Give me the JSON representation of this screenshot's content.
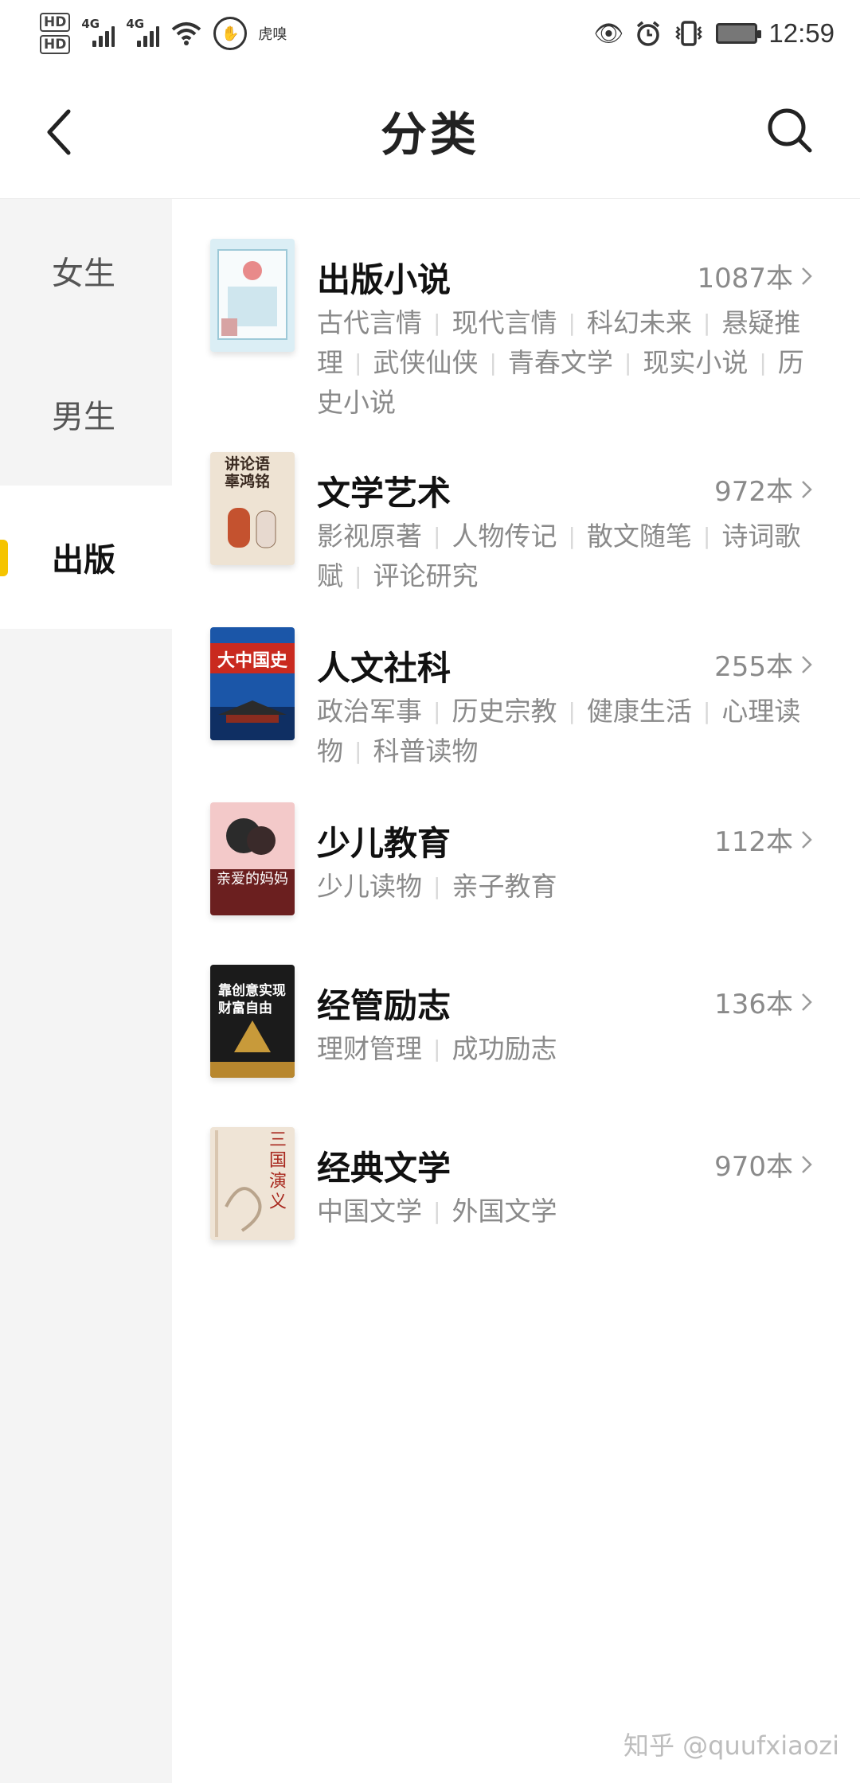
{
  "status_bar": {
    "hd1": "HD",
    "hd2": "HD",
    "net1": "4G",
    "net2": "4G",
    "carrier_text": "虎嗅",
    "time": "12:59"
  },
  "header": {
    "title": "分类"
  },
  "sidebar": {
    "items": [
      {
        "label": "女生"
      },
      {
        "label": "男生"
      },
      {
        "label": "出版"
      }
    ]
  },
  "categories": [
    {
      "name": "出版小说",
      "count": "1087本",
      "tags": [
        "古代言情",
        "现代言情",
        "科幻未来",
        "悬疑推理",
        "武侠仙侠",
        "青春文学",
        "现实小说",
        "历史小说"
      ]
    },
    {
      "name": "文学艺术",
      "count": "972本",
      "tags": [
        "影视原著",
        "人物传记",
        "散文随笔",
        "诗词歌赋",
        "评论研究"
      ],
      "cover_text": "讲论语 辜鸿铭"
    },
    {
      "name": "人文社科",
      "count": "255本",
      "tags": [
        "政治军事",
        "历史宗教",
        "健康生活",
        "心理读物",
        "科普读物"
      ],
      "cover_text": "大中国史"
    },
    {
      "name": "少儿教育",
      "count": "112本",
      "tags": [
        "少儿读物",
        "亲子教育"
      ],
      "cover_text": "亲爱的妈妈"
    },
    {
      "name": "经管励志",
      "count": "136本",
      "tags": [
        "理财管理",
        "成功励志"
      ],
      "cover_text": "靠创意实现财富自由"
    },
    {
      "name": "经典文学",
      "count": "970本",
      "tags": [
        "中国文学",
        "外国文学"
      ],
      "cover_text": "三国演义"
    }
  ],
  "watermark": "知乎 @quufxiaozi",
  "colors": {
    "accent": "#f5c400",
    "sidebar_bg": "#f4f4f4",
    "muted_text": "#8a8a8a"
  }
}
